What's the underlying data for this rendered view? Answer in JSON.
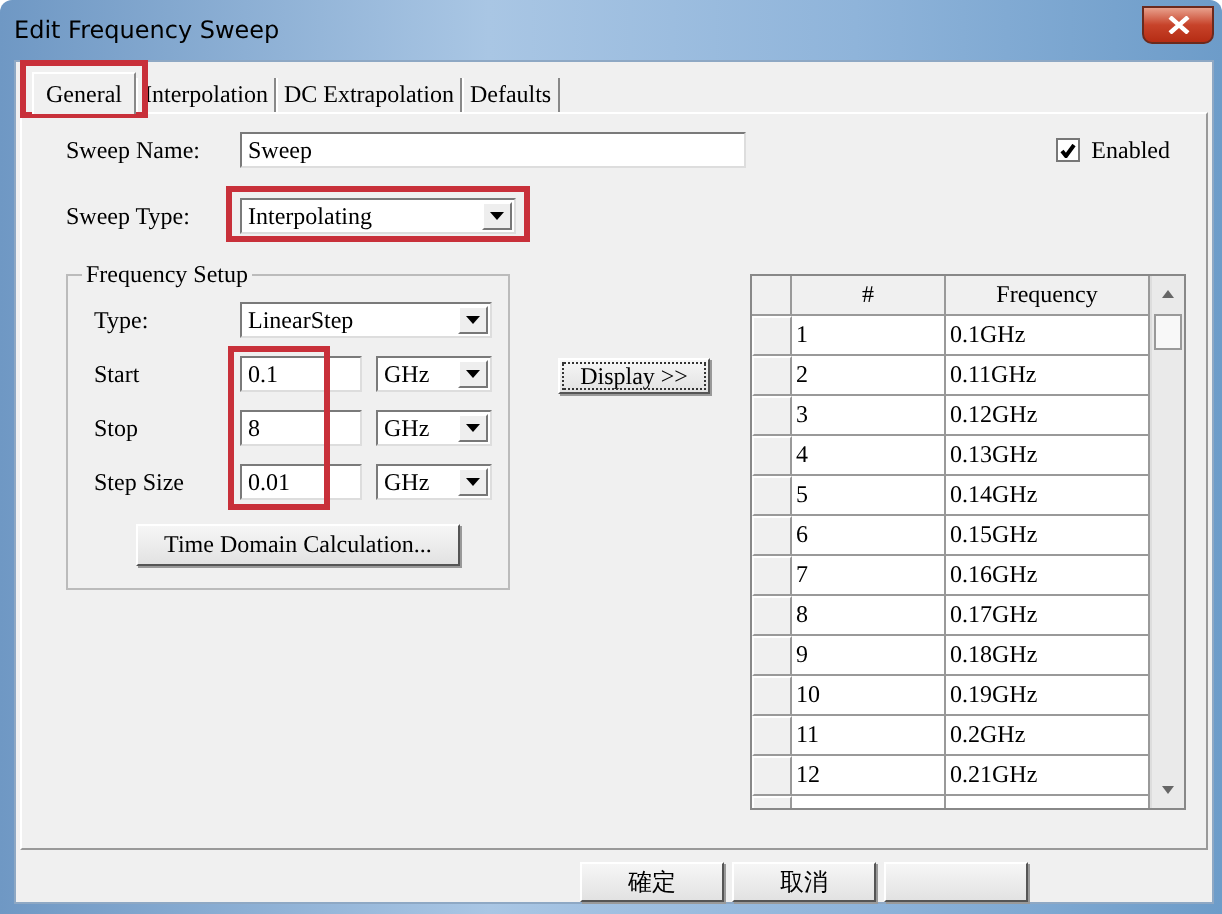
{
  "window": {
    "title": "Edit Frequency Sweep"
  },
  "tabs": [
    {
      "label": "General",
      "selected": true,
      "highlighted": true
    },
    {
      "label": "Interpolation",
      "selected": false,
      "highlighted": false
    },
    {
      "label": "DC Extrapolation",
      "selected": false,
      "highlighted": false
    },
    {
      "label": "Defaults",
      "selected": false,
      "highlighted": false
    }
  ],
  "sweep_name": {
    "label": "Sweep Name:",
    "value": "Sweep"
  },
  "enabled": {
    "label": "Enabled",
    "checked": true
  },
  "sweep_type": {
    "label": "Sweep Type:",
    "value": "Interpolating",
    "highlighted": true
  },
  "frequency_setup": {
    "title": "Frequency Setup",
    "type": {
      "label": "Type:",
      "value": "LinearStep"
    },
    "rows": [
      {
        "label": "Start",
        "value": "0.1",
        "unit": "GHz"
      },
      {
        "label": "Stop",
        "value": "8",
        "unit": "GHz"
      },
      {
        "label": "Step Size",
        "value": "0.01",
        "unit": "GHz"
      }
    ],
    "values_highlighted": true,
    "button": "Time Domain Calculation..."
  },
  "display_button": "Display >>",
  "table": {
    "columns": [
      "#",
      "Frequency"
    ],
    "rows": [
      [
        "1",
        "0.1GHz"
      ],
      [
        "2",
        "0.11GHz"
      ],
      [
        "3",
        "0.12GHz"
      ],
      [
        "4",
        "0.13GHz"
      ],
      [
        "5",
        "0.14GHz"
      ],
      [
        "6",
        "0.15GHz"
      ],
      [
        "7",
        "0.16GHz"
      ],
      [
        "8",
        "0.17GHz"
      ],
      [
        "9",
        "0.18GHz"
      ],
      [
        "10",
        "0.19GHz"
      ],
      [
        "11",
        "0.2GHz"
      ],
      [
        "12",
        "0.21GHz"
      ]
    ]
  },
  "buttons": [
    "確定",
    "取消"
  ]
}
